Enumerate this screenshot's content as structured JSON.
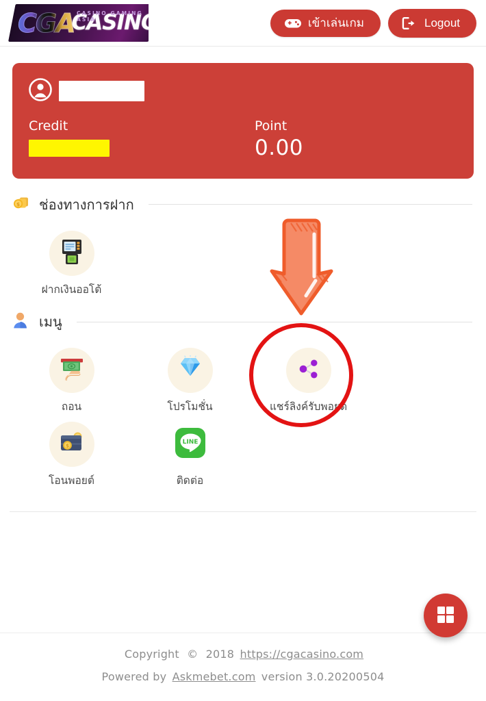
{
  "header": {
    "logo": {
      "mark": "CGA",
      "word": "CASINO",
      "tagline": "CASINO GAMING ASIA"
    },
    "buttons": [
      {
        "label": "เข้าเล่นเกม",
        "icon": "gamepad-icon",
        "name": "enter-game-button"
      },
      {
        "label": "Logout",
        "icon": "logout-icon",
        "name": "logout-button"
      }
    ]
  },
  "balance_card": {
    "username_redacted": true,
    "avatar_icon": "user-circle-icon",
    "credit_label": "Credit",
    "credit_value_redacted": true,
    "point_label": "Point",
    "point_value": "0.00",
    "bg_color": "#cc4038",
    "redaction_colors": {
      "username": "#ffffff",
      "credit": "#fff600"
    }
  },
  "sections": [
    {
      "id": "deposit",
      "icon": "coins-icon",
      "title": "ช่องทางการฝาก",
      "tiles": [
        {
          "label": "ฝากเงินออโต้",
          "icon": "atm-machine-icon",
          "name": "tile-auto-deposit"
        }
      ]
    },
    {
      "id": "menu",
      "icon": "person-icon",
      "title": "เมนู",
      "tiles": [
        {
          "label": "ถอน",
          "icon": "cash-withdraw-icon",
          "name": "tile-withdraw"
        },
        {
          "label": "โปรโมชั่น",
          "icon": "diamond-icon",
          "name": "tile-promotion"
        },
        {
          "label": "แชร์ลิงค์รับพอยต์",
          "icon": "share-nodes-icon",
          "name": "tile-share-link-points"
        },
        {
          "label": "โอนพอยต์",
          "icon": "wallet-coins-icon",
          "name": "tile-transfer-points"
        },
        {
          "label": "ติดต่อ",
          "icon": "line-app-icon",
          "name": "tile-contact"
        }
      ]
    }
  ],
  "annotations": {
    "arrow": {
      "icon": "down-arrow-annotation",
      "color": "#f2643c"
    },
    "highlight_circle": {
      "icon": "circle-highlight-annotation",
      "color": "#e31313",
      "targets": "tile-share-link-points"
    }
  },
  "fab": {
    "icon": "grid-menu-icon",
    "name": "floating-menu-button",
    "color": "#d13a33"
  },
  "footer": {
    "copyright_prefix": "Copyright",
    "copyright_symbol": "©",
    "copyright_year": "2018",
    "site_url": "https://cgacasino.com",
    "powered_prefix": "Powered by",
    "powered_link": "Askmebet.com",
    "version": "version 3.0.20200504"
  }
}
